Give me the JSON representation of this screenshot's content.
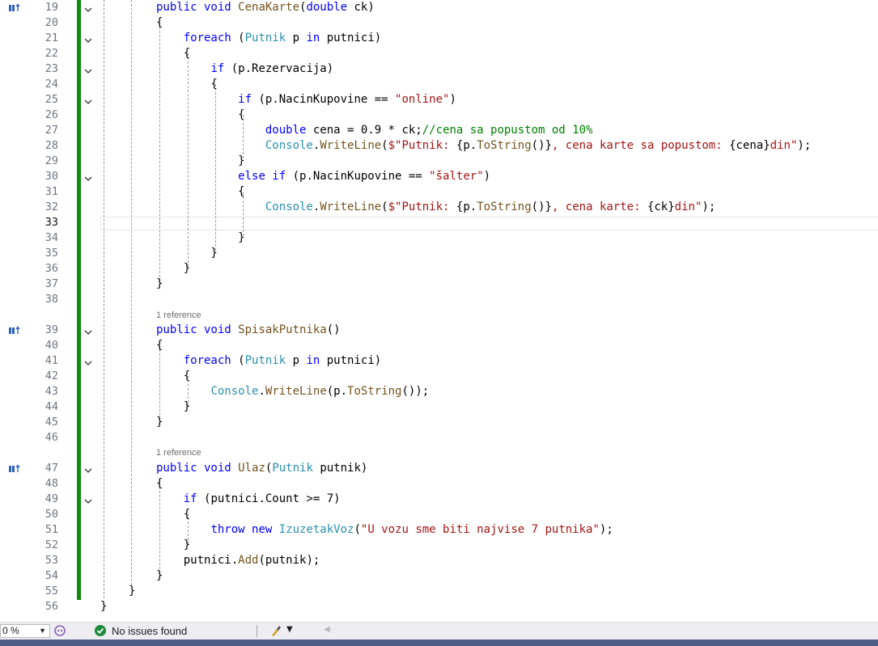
{
  "editor": {
    "lines": [
      {
        "n": "19",
        "code": [
          [
            "kw",
            "public void "
          ],
          [
            "fn",
            "CenaKarte"
          ],
          [
            "",
            "("
          ],
          [
            "kw",
            "double "
          ],
          [
            "",
            "ck)"
          ]
        ]
      },
      {
        "n": "20",
        "code": [
          [
            "",
            "{"
          ]
        ]
      },
      {
        "n": "21",
        "code": [
          [
            "",
            "    "
          ],
          [
            "kw",
            "foreach "
          ],
          [
            "",
            "("
          ],
          [
            "cls",
            "Putnik"
          ],
          [
            "",
            " p "
          ],
          [
            "kw",
            "in"
          ],
          [
            "",
            " putnici)"
          ]
        ]
      },
      {
        "n": "22",
        "code": [
          [
            "",
            "    {"
          ]
        ]
      },
      {
        "n": "23",
        "code": [
          [
            "",
            "        "
          ],
          [
            "kw",
            "if "
          ],
          [
            "",
            "(p.Rezervacija)"
          ]
        ]
      },
      {
        "n": "24",
        "code": [
          [
            "",
            "        {"
          ]
        ]
      },
      {
        "n": "25",
        "code": [
          [
            "",
            "            "
          ],
          [
            "kw",
            "if "
          ],
          [
            "",
            "(p.NacinKupovine == "
          ],
          [
            "str",
            "\"online\""
          ],
          [
            "",
            ")"
          ]
        ]
      },
      {
        "n": "26",
        "code": [
          [
            "",
            "            {"
          ]
        ]
      },
      {
        "n": "27",
        "code": [
          [
            "",
            "                "
          ],
          [
            "kw",
            "double "
          ],
          [
            "",
            "cena = 0.9 * ck;"
          ],
          [
            "cmt",
            "//cena sa popustom od 10%"
          ]
        ]
      },
      {
        "n": "28",
        "code": [
          [
            "",
            "                "
          ],
          [
            "cls",
            "Console"
          ],
          [
            "",
            "."
          ],
          [
            "fn",
            "WriteLine"
          ],
          [
            "",
            "("
          ],
          [
            "str",
            "$\"Putnik: "
          ],
          [
            "",
            "{p."
          ],
          [
            "fn",
            "ToString"
          ],
          [
            "",
            "()}"
          ],
          [
            "str",
            ", cena karte sa popustom: "
          ],
          [
            "",
            "{cena}"
          ],
          [
            "str",
            "din\""
          ],
          [
            "",
            ");"
          ]
        ]
      },
      {
        "n": "29",
        "code": [
          [
            "",
            "            }"
          ]
        ]
      },
      {
        "n": "30",
        "code": [
          [
            "",
            "            "
          ],
          [
            "kw",
            "else if "
          ],
          [
            "",
            "(p.NacinKupovine == "
          ],
          [
            "str",
            "\"šalter\""
          ],
          [
            "",
            ")"
          ]
        ]
      },
      {
        "n": "31",
        "code": [
          [
            "",
            "            {"
          ]
        ]
      },
      {
        "n": "32",
        "code": [
          [
            "",
            "                "
          ],
          [
            "cls",
            "Console"
          ],
          [
            "",
            "."
          ],
          [
            "fn",
            "WriteLine"
          ],
          [
            "",
            "("
          ],
          [
            "str",
            "$\"Putnik: "
          ],
          [
            "",
            "{p."
          ],
          [
            "fn",
            "ToString"
          ],
          [
            "",
            "()}"
          ],
          [
            "str",
            ", cena karte: "
          ],
          [
            "",
            "{ck}"
          ],
          [
            "str",
            "din\""
          ],
          [
            "",
            ");"
          ]
        ]
      },
      {
        "n": "33",
        "code": [
          [
            "",
            ""
          ]
        ]
      },
      {
        "n": "34",
        "code": [
          [
            "",
            "            }"
          ]
        ]
      },
      {
        "n": "35",
        "code": [
          [
            "",
            "        }"
          ]
        ]
      },
      {
        "n": "36",
        "code": [
          [
            "",
            "    }"
          ]
        ]
      },
      {
        "n": "37",
        "code": [
          [
            "",
            "}"
          ]
        ]
      },
      {
        "n": "38",
        "code": [
          [
            "",
            ""
          ]
        ]
      },
      {
        "n": "39",
        "code": [
          [
            "kw",
            "public void "
          ],
          [
            "fn",
            "SpisakPutnika"
          ],
          [
            "",
            "()"
          ]
        ]
      },
      {
        "n": "40",
        "code": [
          [
            "",
            "{"
          ]
        ]
      },
      {
        "n": "41",
        "code": [
          [
            "",
            "    "
          ],
          [
            "kw",
            "foreach "
          ],
          [
            "",
            "("
          ],
          [
            "cls",
            "Putnik"
          ],
          [
            "",
            " p "
          ],
          [
            "kw",
            "in"
          ],
          [
            "",
            " putnici)"
          ]
        ]
      },
      {
        "n": "42",
        "code": [
          [
            "",
            "    {"
          ]
        ]
      },
      {
        "n": "43",
        "code": [
          [
            "",
            "        "
          ],
          [
            "cls",
            "Console"
          ],
          [
            "",
            "."
          ],
          [
            "fn",
            "WriteLine"
          ],
          [
            "",
            "(p."
          ],
          [
            "fn",
            "ToString"
          ],
          [
            "",
            "());"
          ]
        ]
      },
      {
        "n": "44",
        "code": [
          [
            "",
            "    }"
          ]
        ]
      },
      {
        "n": "45",
        "code": [
          [
            "",
            "}"
          ]
        ]
      },
      {
        "n": "46",
        "code": [
          [
            "",
            ""
          ]
        ]
      },
      {
        "n": "47",
        "code": [
          [
            "kw",
            "public void "
          ],
          [
            "fn",
            "Ulaz"
          ],
          [
            "",
            "("
          ],
          [
            "cls",
            "Putnik"
          ],
          [
            "",
            " putnik)"
          ]
        ]
      },
      {
        "n": "48",
        "code": [
          [
            "",
            "{"
          ]
        ]
      },
      {
        "n": "49",
        "code": [
          [
            "",
            "    "
          ],
          [
            "kw",
            "if "
          ],
          [
            "",
            "(putnici.Count >= 7)"
          ]
        ]
      },
      {
        "n": "50",
        "code": [
          [
            "",
            "    {"
          ]
        ]
      },
      {
        "n": "51",
        "code": [
          [
            "",
            "        "
          ],
          [
            "kw",
            "throw new "
          ],
          [
            "cls",
            "IzuzetakVoz"
          ],
          [
            "",
            "("
          ],
          [
            "str",
            "\"U vozu sme biti najvise 7 putnika\""
          ],
          [
            "",
            ");"
          ]
        ]
      },
      {
        "n": "52",
        "code": [
          [
            "",
            "    }"
          ]
        ]
      },
      {
        "n": "53",
        "code": [
          [
            "",
            "    putnici."
          ],
          [
            "fn",
            "Add"
          ],
          [
            "",
            "(putnik);"
          ]
        ]
      },
      {
        "n": "54",
        "code": [
          [
            "",
            "}"
          ]
        ]
      },
      {
        "n": "55",
        "code": [
          [
            "",
            "}"
          ]
        ]
      },
      {
        "n": "56",
        "code": [
          [
            "",
            "}"
          ]
        ]
      }
    ],
    "references": [
      "1 reference",
      "1 reference"
    ],
    "current_line": "33"
  },
  "statusbar": {
    "zoom_value": "0 %",
    "issues_text": "No issues found"
  },
  "colors": {
    "keyword": "#0000ff",
    "type": "#2b91af",
    "method": "#74531f",
    "string": "#a31515",
    "comment": "#008000",
    "change_bar": "#108a10"
  }
}
